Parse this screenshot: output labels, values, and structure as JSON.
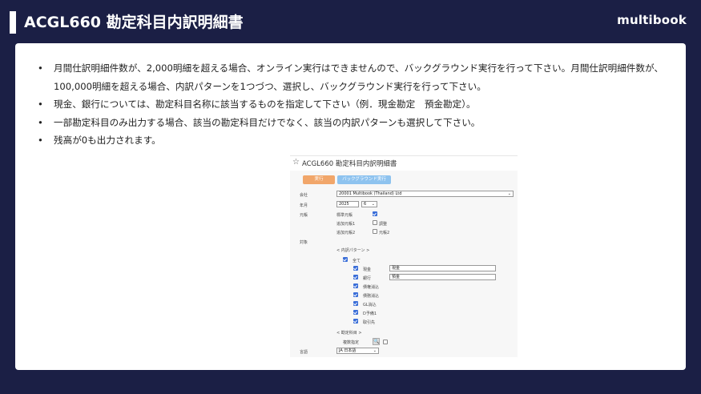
{
  "header": {
    "title": "ACGL660 勘定科目内訳明細書",
    "brand": "multibook"
  },
  "bullets": [
    "月間仕訳明細件数が、2,000明細を超える場合、オンライン実行はできませんので、バックグラウンド実行を行って下さい。月間仕訳明細件数が、100,000明細を超える場合、内訳パターンを1つづつ、選択し、バックグラウンド実行を行って下さい。",
    "現金、銀行については、勘定科目名称に該当するものを指定して下さい（例．現金勘定　預金勘定）。",
    "一部勘定科目のみ出力する場合、該当の勘定科目だけでなく、該当の内訳パターンも選択して下さい。",
    "残高が0も出力されます。"
  ],
  "bullet_mark": "•",
  "screen": {
    "title": "ACGL660 勘定科目内訳明細書",
    "star_icon": "☆",
    "run_button": "実行",
    "background_button": "バックグラウンド実行",
    "company_label": "会社",
    "company_value": "20001 Multibook (Thailand) Ltd",
    "year_month_label": "年月",
    "year_value": "2025",
    "month_value": "6",
    "ledger_label": "元帳",
    "std_ledger_label": "標準元帳",
    "add_ledger1_label": "追加元帳1",
    "adjust_label": "調整",
    "add_ledger2_label": "追加元帳2",
    "ledger2_label": "元帳2",
    "target_label": "対象",
    "pattern_section": "< 内訳パターン >",
    "all_label": "全て",
    "patterns": [
      {
        "label": "現金",
        "value": "現金"
      },
      {
        "label": "銀行",
        "value": "預金"
      },
      {
        "label": "債権消込"
      },
      {
        "label": "債務消込"
      },
      {
        "label": "GL消込"
      },
      {
        "label": "D予備1"
      },
      {
        "label": "取引先"
      }
    ],
    "account_section": "< 勘定科目 >",
    "multi_select_label": "複数指定",
    "language_label": "言語",
    "language_value": "JA 日本語",
    "search_icon": "🔍",
    "chevron_icon": "⌄"
  }
}
